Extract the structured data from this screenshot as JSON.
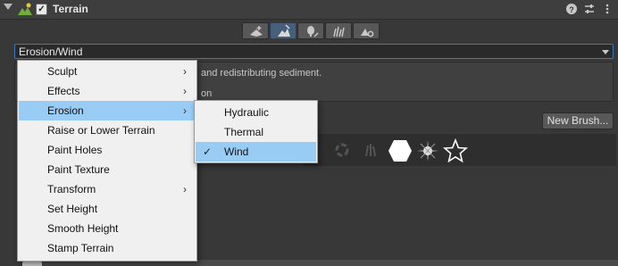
{
  "component": {
    "title": "Terrain",
    "enabled": true
  },
  "header_icons": [
    "help-icon",
    "preset-icon",
    "more-icon"
  ],
  "toolbar": {
    "tools": [
      {
        "name": "create-neighbor-tool",
        "selected": false
      },
      {
        "name": "paint-terrain-tool",
        "selected": true
      },
      {
        "name": "paint-trees-tool",
        "selected": false
      },
      {
        "name": "paint-details-tool",
        "selected": false
      },
      {
        "name": "terrain-settings-tool",
        "selected": false
      }
    ]
  },
  "dropdown": {
    "value": "Erosion/Wind"
  },
  "help": {
    "line1": "and redistributing sediment.",
    "line2": "on"
  },
  "new_brush_label": "New Brush...",
  "menu": {
    "items": [
      {
        "label": "Sculpt",
        "submenu": true
      },
      {
        "label": "Effects",
        "submenu": true
      },
      {
        "label": "Erosion",
        "submenu": true,
        "highlighted": true
      },
      {
        "label": "Raise or Lower Terrain",
        "submenu": false
      },
      {
        "label": "Paint Holes",
        "submenu": false
      },
      {
        "label": "Paint Texture",
        "submenu": false
      },
      {
        "label": "Transform",
        "submenu": true
      },
      {
        "label": "Set Height",
        "submenu": false
      },
      {
        "label": "Smooth Height",
        "submenu": false
      },
      {
        "label": "Stamp Terrain",
        "submenu": false
      }
    ]
  },
  "submenu": {
    "items": [
      {
        "label": "Hydraulic",
        "checked": false
      },
      {
        "label": "Thermal",
        "checked": false
      },
      {
        "label": "Wind",
        "checked": true,
        "highlighted": true
      }
    ]
  },
  "colors": {
    "background": "#383838",
    "menu_bg": "#f0f0f0",
    "menu_highlight": "#99ccf5",
    "dropdown_border": "#3a79bb"
  }
}
